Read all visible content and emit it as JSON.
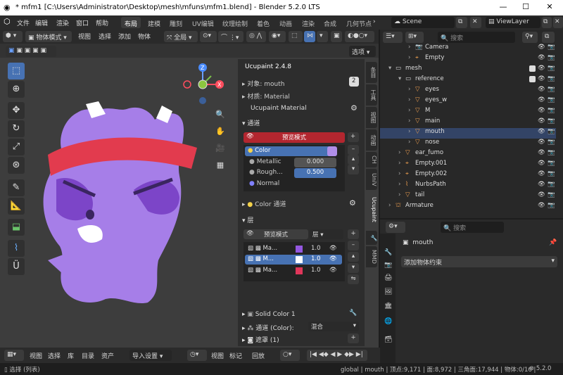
{
  "titlebar": {
    "title": "* mfm1 [C:\\Users\\Administrator\\Desktop\\mesh\\mfuns\\mfm1.blend] - Blender 5.2.0 LTS",
    "min": "—",
    "max": "☐",
    "close": "✕"
  },
  "menu": [
    "文件",
    "编辑",
    "渲染",
    "窗口",
    "帮助"
  ],
  "workspaces": [
    "布局",
    "建模",
    "雕刻",
    "UV编辑",
    "纹理绘制",
    "着色",
    "动画",
    "渲染",
    "合成",
    "几何节点"
  ],
  "scene": "Scene",
  "viewlayer": "ViewLayer",
  "vp_header": {
    "mode": "物体模式",
    "view": "视图",
    "select": "选择",
    "add": "添加",
    "object": "物体",
    "global": "全局",
    "options": "选项"
  },
  "npanel": {
    "title": "Ucupaint 2.4.8",
    "object_label": "对象: mouth",
    "material_label": "材质: Material",
    "ucu_material": "Ucupaint Material",
    "channels": "通道",
    "preview_mode": "预览模式",
    "color": "Color",
    "metallic": "Metallic",
    "metallic_val": "0.000",
    "roughness": "Rough...",
    "roughness_val": "0.500",
    "normal": "Normal",
    "color_channel": "Color 通道",
    "layers": "层",
    "layer_preview": "预览模式",
    "layer_type": "层",
    "layer_rows": [
      {
        "name": "Ma...",
        "val": "1.0"
      },
      {
        "name": "M...",
        "val": "1.0"
      },
      {
        "name": "Ma...",
        "val": "1.0"
      }
    ],
    "solid_color": "Solid Color 1",
    "channel_color": "通道 (Color):",
    "blend_mode": "混合",
    "mask": "遮罩 (1)"
  },
  "vtabs": [
    "条目",
    "工具",
    "视图",
    "动画",
    "CH",
    "UniV",
    "Ucupaint",
    "MMD"
  ],
  "outliner": {
    "search": "搜索",
    "items": [
      {
        "name": "Camera",
        "indent": 3
      },
      {
        "name": "Empty",
        "indent": 3
      },
      {
        "name": "mesh",
        "indent": 1
      },
      {
        "name": "reference",
        "indent": 2
      },
      {
        "name": "eyes",
        "indent": 3
      },
      {
        "name": "eyes_w",
        "indent": 3
      },
      {
        "name": "M",
        "indent": 3
      },
      {
        "name": "main",
        "indent": 3
      },
      {
        "name": "mouth",
        "indent": 3
      },
      {
        "name": "nose",
        "indent": 3
      },
      {
        "name": "ear_fumo",
        "indent": 2
      },
      {
        "name": "Empty.001",
        "indent": 2
      },
      {
        "name": "Empty.002",
        "indent": 2
      },
      {
        "name": "NurbsPath",
        "indent": 2
      },
      {
        "name": "tail",
        "indent": 2
      },
      {
        "name": "Armature",
        "indent": 1
      }
    ]
  },
  "props": {
    "search": "搜索",
    "object": "mouth",
    "add_constraint": "添加物体约束"
  },
  "timeline": {
    "view": "视图",
    "select": "选择",
    "lib": "库",
    "catalog": "目录",
    "assets": "资产",
    "import": "导入设置",
    "view2": "视图",
    "marker": "标记",
    "playback": "回放"
  },
  "status": {
    "left": "选择 (列表)",
    "right": "global | mouth | 顶点:9,171 | 面:8,972 | 三角面:17,944 | 物体:0/16 |",
    "version": "5.2.0"
  },
  "colors": {
    "accent": "#4772b3",
    "preview_red": "#b3262f",
    "swatch_purple": "#b08ee8",
    "swatch_pink": "#e0365a",
    "char_purple": "#a67ee8",
    "band_red": "#e23b4e"
  }
}
